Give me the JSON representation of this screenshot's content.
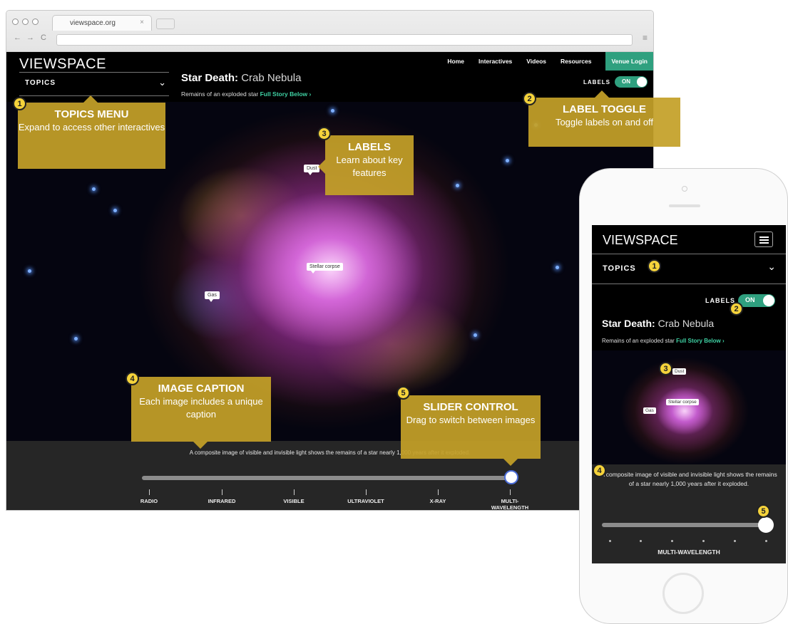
{
  "browser": {
    "tab_title": "viewspace.org",
    "tab_close": "×",
    "back": "←",
    "forward": "→",
    "reload": "C",
    "menu": "≡"
  },
  "site": {
    "logo": "VIEWSPACE",
    "topics_label": "TOPICS",
    "nav": [
      "Home",
      "Interactives",
      "Videos",
      "Resources"
    ],
    "venue_login": "Venue Login",
    "labels_toggle_label": "LABELS",
    "labels_toggle_state": "ON",
    "heading_bold": "Star Death:",
    "heading_light": "Crab Nebula",
    "subtitle": "Remains of an exploded star",
    "full_story_link": "Full Story Below ›",
    "image_labels": [
      "Dust",
      "Stellar corpse",
      "Gas"
    ],
    "caption": "A composite image of visible and invisible light shows the remains of a star nearly 1,000 years after it exploded.",
    "slider_stops": [
      "RADIO",
      "INFRARED",
      "VISIBLE",
      "ULTRAVIOLET",
      "X-RAY",
      "MULTI-WAVELENGTH"
    ],
    "slider_selected": "MULTI-WAVELENGTH"
  },
  "callouts": [
    {
      "number": "1",
      "title": "TOPICS MENU",
      "body": "Expand to access other interactives"
    },
    {
      "number": "2",
      "title": "LABEL TOGGLE",
      "body": "Toggle labels on and off"
    },
    {
      "number": "3",
      "title": "LABELS",
      "body": "Learn about key features"
    },
    {
      "number": "4",
      "title": "IMAGE CAPTION",
      "body": "Each image includes a unique caption"
    },
    {
      "number": "5",
      "title": "SLIDER CONTROL",
      "body": "Drag to switch between images"
    }
  ],
  "mobile": {
    "logo": "VIEWSPACE",
    "topics_label": "TOPICS",
    "labels_toggle_label": "LABELS",
    "labels_toggle_state": "ON",
    "heading_bold": "Star Death:",
    "heading_light": "Crab Nebula",
    "subtitle": "Remains of an exploded star",
    "full_story_link": "Full Story Below ›",
    "image_labels": [
      "Dust",
      "Stellar corpse",
      "Gas"
    ],
    "caption": "A composite image of visible and invisible light shows the remains of a star nearly 1,000 years after it exploded.",
    "slider_selected": "MULTI-WAVELENGTH",
    "markers": [
      "1",
      "2",
      "3",
      "4",
      "5"
    ]
  },
  "colors": {
    "accent_green": "#2fa07f",
    "link_green": "#3fd2a4",
    "callout_gold": "#c4a028",
    "marker_yellow": "#f5d33b"
  },
  "icons": [
    "chevron-down-icon",
    "hamburger-menu-icon",
    "arrow-left-icon",
    "arrow-right-icon",
    "reload-icon"
  ]
}
